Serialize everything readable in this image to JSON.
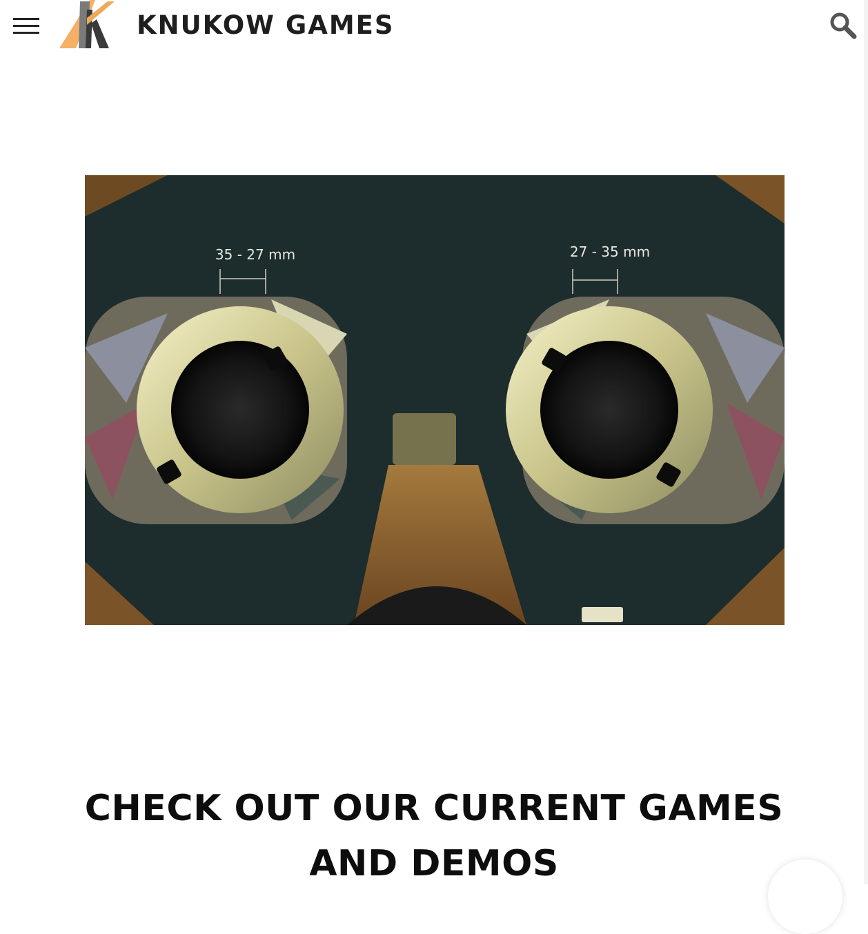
{
  "header": {
    "site_title": "KNUKOW GAMES",
    "menu_icon": "hamburger-menu-icon",
    "search_icon": "search-icon",
    "logo": "knukow-k-logo"
  },
  "hero": {
    "image": "vr-cardboard-headset-photo",
    "left_scale_label": "35 - 27 mm",
    "right_scale_label": "27 - 35 mm"
  },
  "main": {
    "heading_line1": "CHECK OUT OUR CURRENT GAMES",
    "heading_line2": "AND DEMOS"
  },
  "colors": {
    "logo_orange": "#f0a85a",
    "logo_dark": "#3a3a3a",
    "headset_dark": "#1b2a2b",
    "cardboard": "#8a5a2a"
  }
}
